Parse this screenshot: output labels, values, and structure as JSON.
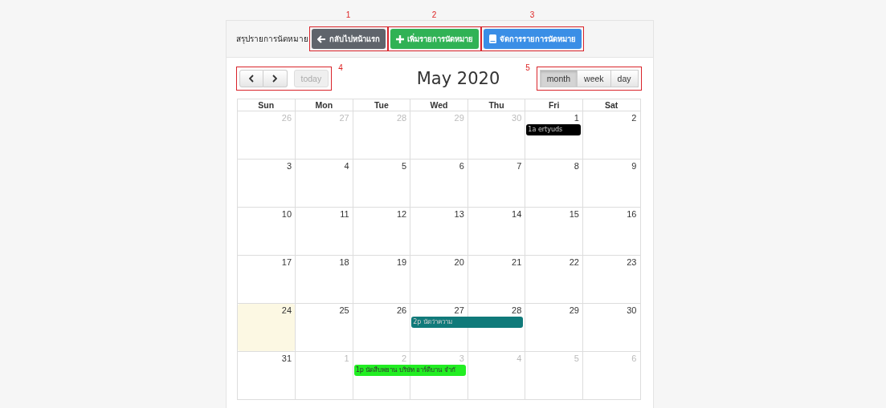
{
  "header": {
    "title": "สรุปรายการนัดหมาย",
    "buttons": [
      {
        "label": "กลับไปหน้าแรก",
        "kind": "back",
        "annotation": "1"
      },
      {
        "label": "เพิ่มรายการนัดหมาย",
        "kind": "add",
        "annotation": "2"
      },
      {
        "label": "จัดการรายการนัดหมาย",
        "kind": "manage",
        "annotation": "3"
      }
    ]
  },
  "toolbar": {
    "nav_annotation": "4",
    "today": {
      "label": "today",
      "disabled": true
    },
    "title": "May 2020",
    "views_annotation": "5",
    "views": [
      {
        "label": "month",
        "selected": true
      },
      {
        "label": "week",
        "selected": false
      },
      {
        "label": "day",
        "selected": false
      }
    ]
  },
  "calendar": {
    "weekdays": [
      "Sun",
      "Mon",
      "Tue",
      "Wed",
      "Thu",
      "Fri",
      "Sat"
    ],
    "weeks": [
      {
        "days": [
          {
            "label": "26",
            "other_month": true,
            "today": false
          },
          {
            "label": "27",
            "other_month": true,
            "today": false
          },
          {
            "label": "28",
            "other_month": true,
            "today": false
          },
          {
            "label": "29",
            "other_month": true,
            "today": false
          },
          {
            "label": "30",
            "other_month": true,
            "today": false
          },
          {
            "label": "1",
            "other_month": false,
            "today": false,
            "event": {
              "text": "1a ertyuds",
              "color": "#000000"
            }
          },
          {
            "label": "2",
            "other_month": false,
            "today": false
          }
        ]
      },
      {
        "days": [
          {
            "label": "3",
            "other_month": false,
            "today": false
          },
          {
            "label": "4",
            "other_month": false,
            "today": false
          },
          {
            "label": "5",
            "other_month": false,
            "today": false
          },
          {
            "label": "6",
            "other_month": false,
            "today": false
          },
          {
            "label": "7",
            "other_month": false,
            "today": false
          },
          {
            "label": "8",
            "other_month": false,
            "today": false
          },
          {
            "label": "9",
            "other_month": false,
            "today": false
          }
        ]
      },
      {
        "days": [
          {
            "label": "10",
            "other_month": false,
            "today": false
          },
          {
            "label": "11",
            "other_month": false,
            "today": false
          },
          {
            "label": "12",
            "other_month": false,
            "today": false
          },
          {
            "label": "13",
            "other_month": false,
            "today": false
          },
          {
            "label": "14",
            "other_month": false,
            "today": false
          },
          {
            "label": "15",
            "other_month": false,
            "today": false
          },
          {
            "label": "16",
            "other_month": false,
            "today": false
          }
        ]
      },
      {
        "days": [
          {
            "label": "17",
            "other_month": false,
            "today": false
          },
          {
            "label": "18",
            "other_month": false,
            "today": false
          },
          {
            "label": "19",
            "other_month": false,
            "today": false
          },
          {
            "label": "20",
            "other_month": false,
            "today": false
          },
          {
            "label": "21",
            "other_month": false,
            "today": false
          },
          {
            "label": "22",
            "other_month": false,
            "today": false
          },
          {
            "label": "23",
            "other_month": false,
            "today": false
          }
        ]
      },
      {
        "days": [
          {
            "label": "24",
            "other_month": false,
            "today": true
          },
          {
            "label": "25",
            "other_month": false,
            "today": false
          },
          {
            "label": "26",
            "other_month": false,
            "today": false
          },
          {
            "label": "27",
            "other_month": false,
            "today": false,
            "event": {
              "text": "2p นัดว่าความ",
              "color": "#107a7a"
            }
          },
          {
            "label": "28",
            "other_month": false,
            "today": false,
            "event_continues": true
          },
          {
            "label": "29",
            "other_month": false,
            "today": false
          },
          {
            "label": "30",
            "other_month": false,
            "today": false
          }
        ]
      },
      {
        "days": [
          {
            "label": "31",
            "other_month": false,
            "today": false
          },
          {
            "label": "1",
            "other_month": true,
            "today": false
          },
          {
            "label": "2",
            "other_month": true,
            "today": false,
            "event": {
              "text": "1p นัดสืบพยาน บริษัท อาร์ดีบาน จำกั",
              "color": "#22ee22"
            }
          },
          {
            "label": "3",
            "other_month": true,
            "today": false,
            "event_continues": true
          },
          {
            "label": "4",
            "other_month": true,
            "today": false
          },
          {
            "label": "5",
            "other_month": true,
            "today": false
          },
          {
            "label": "6",
            "other_month": true,
            "today": false
          }
        ]
      }
    ]
  }
}
